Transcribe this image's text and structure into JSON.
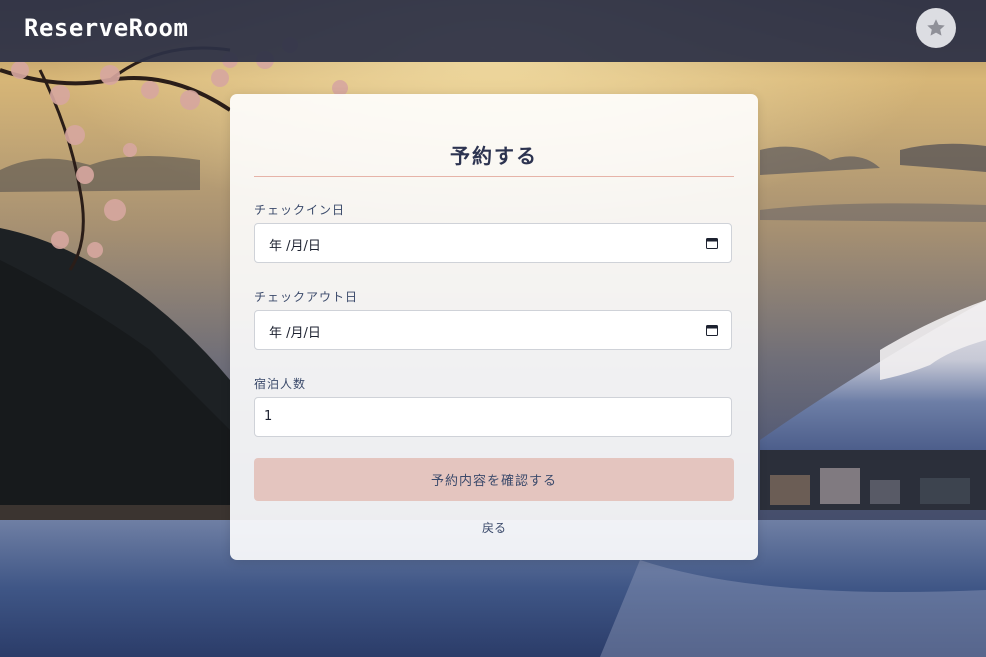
{
  "header": {
    "brand": "ReserveRoom",
    "avatar_icon": "star-icon"
  },
  "form": {
    "title": "予約する",
    "checkin": {
      "label": "チェックイン日",
      "value": "年 /月/日",
      "icon": "calendar-icon"
    },
    "checkout": {
      "label": "チェックアウト日",
      "value": "年 /月/日",
      "icon": "calendar-icon"
    },
    "guests": {
      "label": "宿泊人数",
      "value": "1"
    },
    "submit_label": "予約内容を確認する",
    "back_label": "戻る"
  },
  "colors": {
    "header_bg": "#2c3046",
    "title_text": "#2c3350",
    "accent_rule": "#e6b3a8",
    "button_bg": "#e4c5bf",
    "label_text": "#3b4a6b"
  }
}
